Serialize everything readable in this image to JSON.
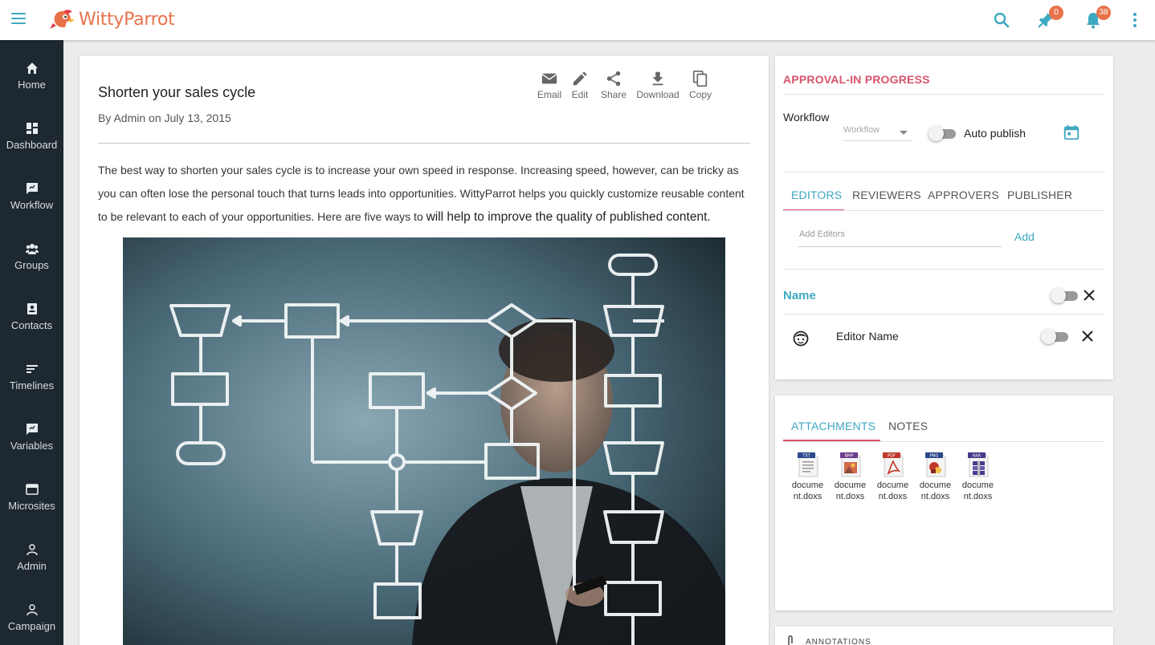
{
  "app": {
    "brand": "WittyParrot",
    "colors": {
      "accent": "#3ea9c1",
      "brand": "#e8734a",
      "status": "#d9536f",
      "sidebar": "#1e2830"
    }
  },
  "topbar": {
    "pin_badge": "0",
    "bell_badge": "38"
  },
  "sidebar": {
    "items": [
      {
        "label": "Home",
        "icon": "home-icon"
      },
      {
        "label": "Dashboard",
        "icon": "dashboard-icon"
      },
      {
        "label": "Workflow",
        "icon": "workflow-icon"
      },
      {
        "label": "Groups",
        "icon": "groups-icon"
      },
      {
        "label": "Contacts",
        "icon": "contacts-icon"
      },
      {
        "label": "Timelines",
        "icon": "timelines-icon"
      },
      {
        "label": "Variables",
        "icon": "variables-icon"
      },
      {
        "label": "Microsites",
        "icon": "microsites-icon"
      },
      {
        "label": "Admin",
        "icon": "admin-icon"
      },
      {
        "label": "Campaign",
        "icon": "campaign-icon"
      }
    ]
  },
  "post": {
    "title": "Shorten your sales cycle",
    "meta": "By Admin on July 13, 2015",
    "body_main": "The best way to shorten your sales cycle is to increase your own speed in response. Increasing speed, however, can be tricky as you can often lose the personal touch that turns leads into opportunities. WittyParrot helps you quickly customize reusable content to be relevant to each of your opportunities. Here are five ways to ",
    "body_emphasis": "will help to improve the quality of published content.",
    "actions": [
      {
        "label": "Email",
        "icon": "email-icon"
      },
      {
        "label": "Edit",
        "icon": "edit-icon"
      },
      {
        "label": "Share",
        "icon": "share-icon"
      },
      {
        "label": "Download",
        "icon": "download-icon"
      },
      {
        "label": "Copy",
        "icon": "copy-icon"
      }
    ]
  },
  "approval": {
    "status": "APPROVAL-IN PROGRESS",
    "workflow_label": "Workflow",
    "workflow_select": "Workflow",
    "auto_publish": "Auto publish",
    "tabs": [
      "EDITORS",
      "REVIEWERS",
      "APPROVERS",
      "PUBLISHER"
    ],
    "active_tab": "EDITORS",
    "input_placeholder": "Add Editors",
    "add_label": "Add",
    "name_header": "Name",
    "editor_name": "Editor Name"
  },
  "attachments": {
    "tabs": [
      "ATTACHMENTS",
      "NOTES"
    ],
    "files": [
      {
        "type": "TXT",
        "name": "docume nt.doxs",
        "color": "#2b4a8c"
      },
      {
        "type": "BMP",
        "name": "docume nt.doxs",
        "color": "#6a3d8c"
      },
      {
        "type": "PDF",
        "name": "docume nt.doxs",
        "color": "#c0392b"
      },
      {
        "type": "PNG",
        "name": "docume nt.doxs",
        "color": "#2b4a8c"
      },
      {
        "type": "RAR",
        "name": "docume nt.doxs",
        "color": "#4a3a8c"
      }
    ]
  },
  "annotations": {
    "label": "ANNOTATIONS"
  }
}
